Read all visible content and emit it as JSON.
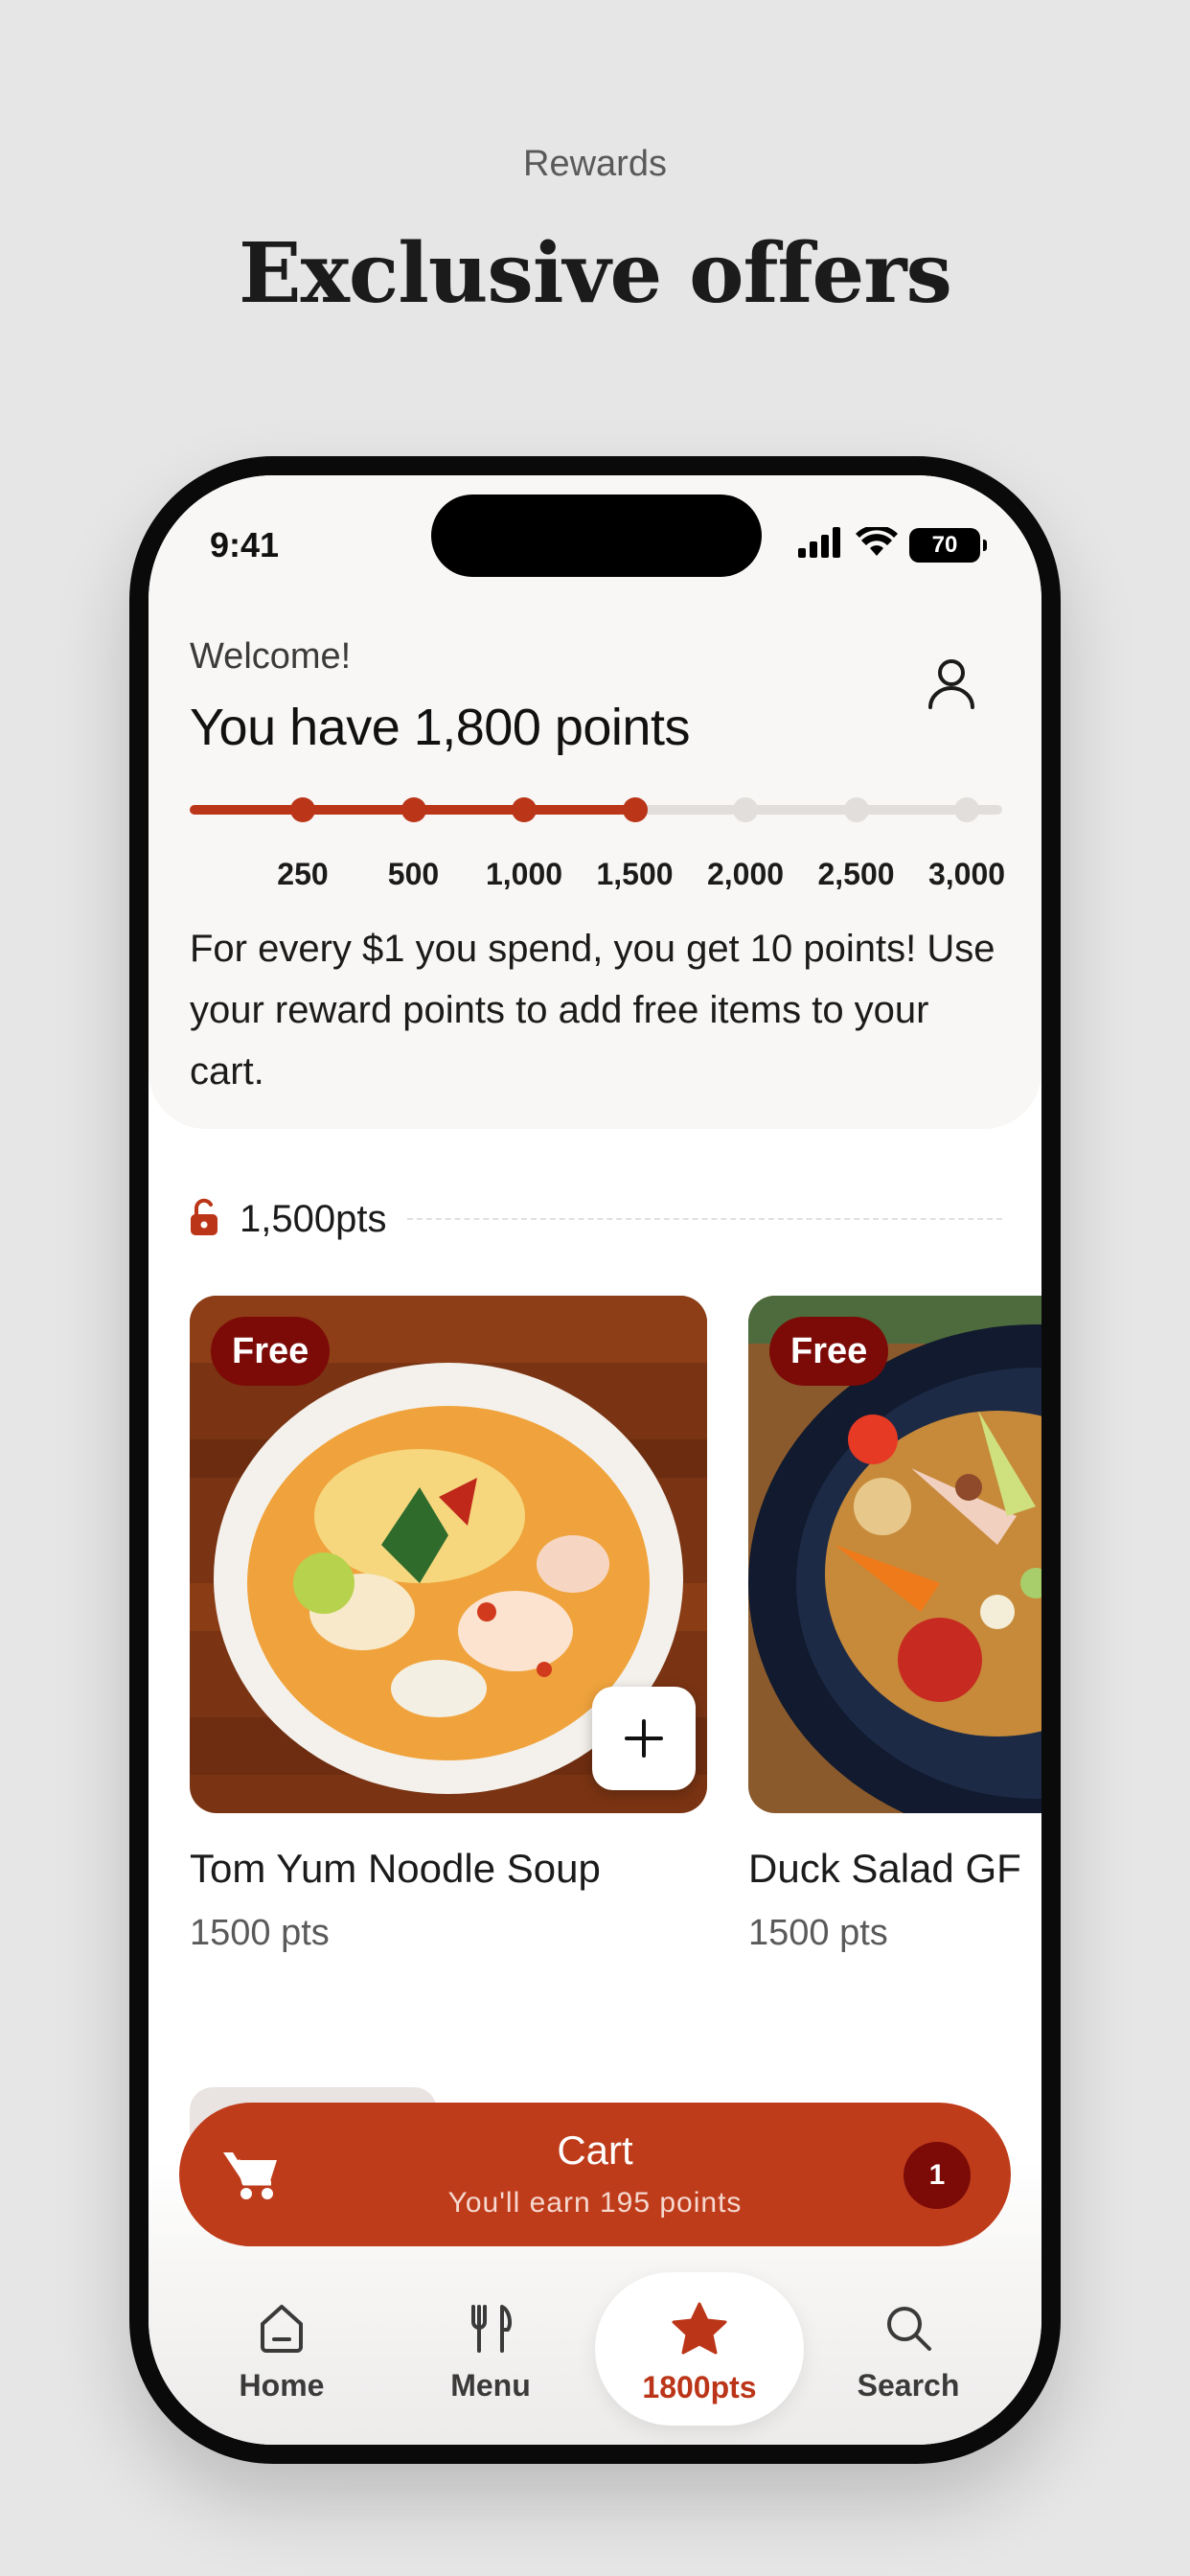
{
  "page": {
    "eyebrow": "Rewards",
    "headline": "Exclusive offers"
  },
  "status_bar": {
    "time": "9:41",
    "battery": "70",
    "icons": [
      "signal-icon",
      "wifi-icon",
      "battery-icon"
    ]
  },
  "header": {
    "welcome": "Welcome!",
    "points_title": "You have 1,800 points",
    "profile_icon": "person-icon"
  },
  "progress": {
    "current_points": 1800,
    "max_points": 3000,
    "fill_fraction": 0.55,
    "milestones": [
      {
        "label": "250",
        "reached": true
      },
      {
        "label": "500",
        "reached": true
      },
      {
        "label": "1,000",
        "reached": true
      },
      {
        "label": "1,500",
        "reached": true
      },
      {
        "label": "2,000",
        "reached": false
      },
      {
        "label": "2,500",
        "reached": false
      },
      {
        "label": "3,000",
        "reached": false
      }
    ]
  },
  "description": "For every $1 you spend, you get 10 points! Use your reward points to add free items to your cart.",
  "tier": {
    "label": "1,500pts",
    "icon": "unlock-icon"
  },
  "items": [
    {
      "name": "Tom Yum Noodle Soup",
      "points": "1500 pts",
      "badge": "Free",
      "image": "noodle-soup-photo"
    },
    {
      "name": "Duck Salad GF",
      "points": "1500 pts",
      "badge": "Free",
      "image": "duck-salad-photo"
    }
  ],
  "cart": {
    "title": "Cart",
    "subtitle": "You'll earn 195 points",
    "count": "1",
    "icon": "cart-icon"
  },
  "nav": {
    "items": [
      {
        "label": "Home",
        "icon": "home-icon"
      },
      {
        "label": "Menu",
        "icon": "utensils-icon"
      },
      {
        "label": "1800pts",
        "icon": "star-icon",
        "active": true
      },
      {
        "label": "Search",
        "icon": "search-icon"
      }
    ]
  },
  "colors": {
    "accent": "#bb3518",
    "badge": "#7c0b08",
    "track": "#e1dedb",
    "background": "#e6e6e6"
  }
}
